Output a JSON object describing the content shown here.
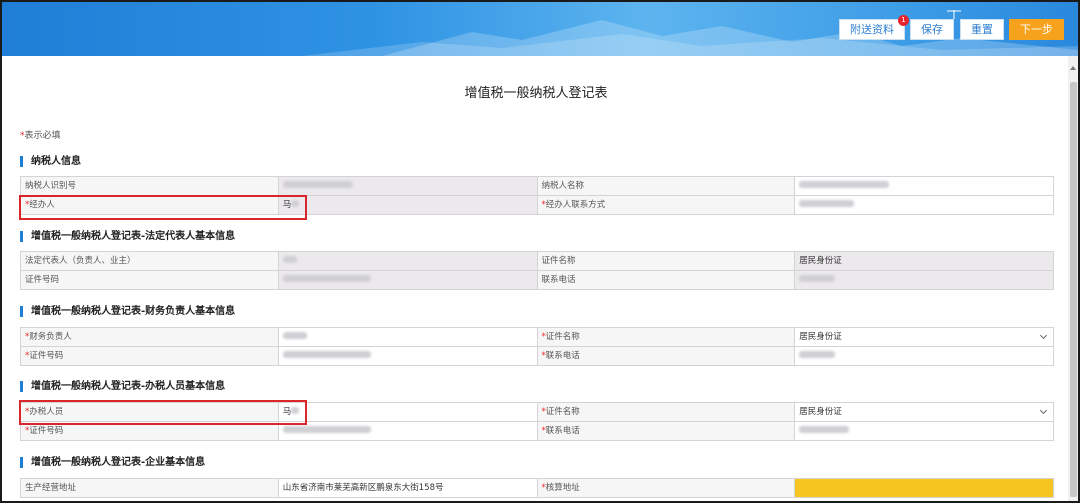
{
  "toolbar": {
    "attach_label": "附送资料",
    "attach_badge": "1",
    "save_label": "保存",
    "reset_label": "重置",
    "next_label": "下一步"
  },
  "form": {
    "title": "增值税一般纳税人登记表",
    "required_mark": "*",
    "required_note": "表示必填"
  },
  "sections": [
    {
      "title": "纳税人信息",
      "rows": [
        [
          {
            "label": "纳税人识别号",
            "required": false
          },
          {
            "value": "",
            "blur": 70
          },
          {
            "label": "纳税人名称",
            "required": false
          },
          {
            "value": "",
            "blur": 90
          }
        ],
        [
          {
            "label": "经办人",
            "required": true
          },
          {
            "value": "马",
            "blur": 8
          },
          {
            "label": "经办人联系方式",
            "required": true
          },
          {
            "value": "",
            "blur": 55
          }
        ]
      ]
    },
    {
      "title": "增值税一般纳税人登记表-法定代表人基本信息",
      "rows": [
        [
          {
            "label": "法定代表人（负责人、业主）",
            "required": false
          },
          {
            "value": "",
            "blur": 14
          },
          {
            "label": "证件名称",
            "required": false
          },
          {
            "value": "居民身份证"
          }
        ],
        [
          {
            "label": "证件号码",
            "required": false
          },
          {
            "value": "",
            "blur": 88
          },
          {
            "label": "联系电话",
            "required": false
          },
          {
            "value": "",
            "blur": 36
          }
        ]
      ]
    },
    {
      "title": "增值税一般纳税人登记表-财务负责人基本信息",
      "rows": [
        [
          {
            "label": "财务负责人",
            "required": true
          },
          {
            "value": "",
            "blur": 24
          },
          {
            "label": "证件名称",
            "required": true
          },
          {
            "value": "居民身份证",
            "select": true
          }
        ],
        [
          {
            "label": "证件号码",
            "required": true
          },
          {
            "value": "",
            "blur": 88
          },
          {
            "label": "联系电话",
            "required": true
          },
          {
            "value": "",
            "blur": 36
          }
        ]
      ]
    },
    {
      "title": "增值税一般纳税人登记表-办税人员基本信息",
      "rows": [
        [
          {
            "label": "办税人员",
            "required": true
          },
          {
            "value": "马",
            "blur": 8
          },
          {
            "label": "证件名称",
            "required": true
          },
          {
            "value": "居民身份证",
            "select": true
          }
        ],
        [
          {
            "label": "证件号码",
            "required": true
          },
          {
            "value": "",
            "blur": 88
          },
          {
            "label": "联系电话",
            "required": true
          },
          {
            "value": "",
            "blur": 50
          }
        ]
      ]
    },
    {
      "title": "增值税一般纳税人登记表-企业基本信息",
      "rows": [
        [
          {
            "label": "生产经营地址",
            "required": false
          },
          {
            "value": "山东省济南市莱芜高新区鹏泉东大街158号"
          },
          {
            "label": "核算地址",
            "required": true
          },
          {
            "value": "",
            "yellow": true
          }
        ]
      ]
    }
  ],
  "colors": {
    "accent": "#1f7ed6",
    "primary_button": "#f6a21c",
    "highlight_box": "#d8262a",
    "required_star": "#e22222"
  }
}
